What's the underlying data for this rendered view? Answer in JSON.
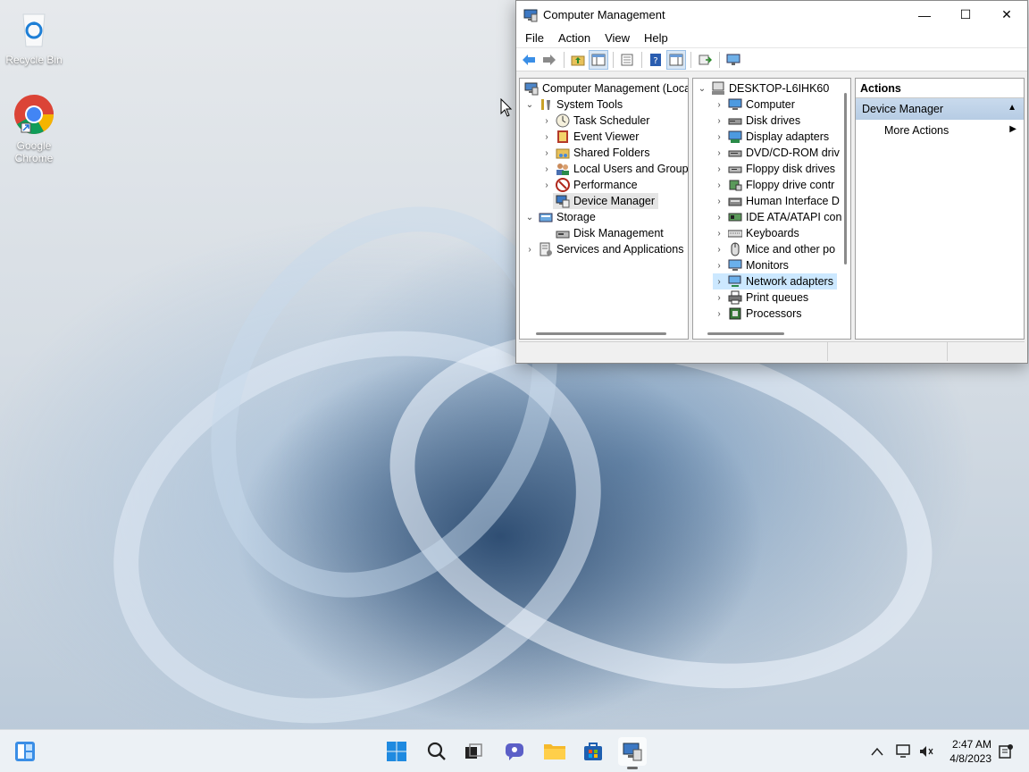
{
  "desktop": {
    "icons": [
      {
        "label": "Recycle Bin"
      },
      {
        "label": "Google Chrome"
      }
    ]
  },
  "window": {
    "title": "Computer Management",
    "controls": {
      "minimize": "—",
      "maximize": "☐",
      "close": "✕"
    },
    "menu": [
      "File",
      "Action",
      "View",
      "Help"
    ],
    "left_tree": [
      {
        "label": "Computer Management (Local",
        "chev": ""
      },
      {
        "label": "System Tools",
        "chev": "⌄"
      },
      {
        "label": "Task Scheduler",
        "chev": "›"
      },
      {
        "label": "Event Viewer",
        "chev": "›"
      },
      {
        "label": "Shared Folders",
        "chev": "›"
      },
      {
        "label": "Local Users and Groups",
        "chev": "›"
      },
      {
        "label": "Performance",
        "chev": "›"
      },
      {
        "label": "Device Manager",
        "chev": ""
      },
      {
        "label": "Storage",
        "chev": "⌄"
      },
      {
        "label": "Disk Management",
        "chev": ""
      },
      {
        "label": "Services and Applications",
        "chev": "›"
      }
    ],
    "device_tree": [
      {
        "label": "DESKTOP-L6IHK60",
        "chev": "⌄"
      },
      {
        "label": "Computer",
        "chev": "›"
      },
      {
        "label": "Disk drives",
        "chev": "›"
      },
      {
        "label": "Display adapters",
        "chev": "›"
      },
      {
        "label": "DVD/CD-ROM driv",
        "chev": "›"
      },
      {
        "label": "Floppy disk drives",
        "chev": "›"
      },
      {
        "label": "Floppy drive contr",
        "chev": "›"
      },
      {
        "label": "Human Interface D",
        "chev": "›"
      },
      {
        "label": "IDE ATA/ATAPI con",
        "chev": "›"
      },
      {
        "label": "Keyboards",
        "chev": "›"
      },
      {
        "label": "Mice and other po",
        "chev": "›"
      },
      {
        "label": "Monitors",
        "chev": "›"
      },
      {
        "label": "Network adapters",
        "chev": "›"
      },
      {
        "label": "Print queues",
        "chev": "›"
      },
      {
        "label": "Processors",
        "chev": "›"
      }
    ],
    "actions": {
      "header": "Actions",
      "section": "Device Manager",
      "item": "More Actions"
    }
  },
  "taskbar": {
    "time": "2:47 AM",
    "date": "4/8/2023"
  }
}
